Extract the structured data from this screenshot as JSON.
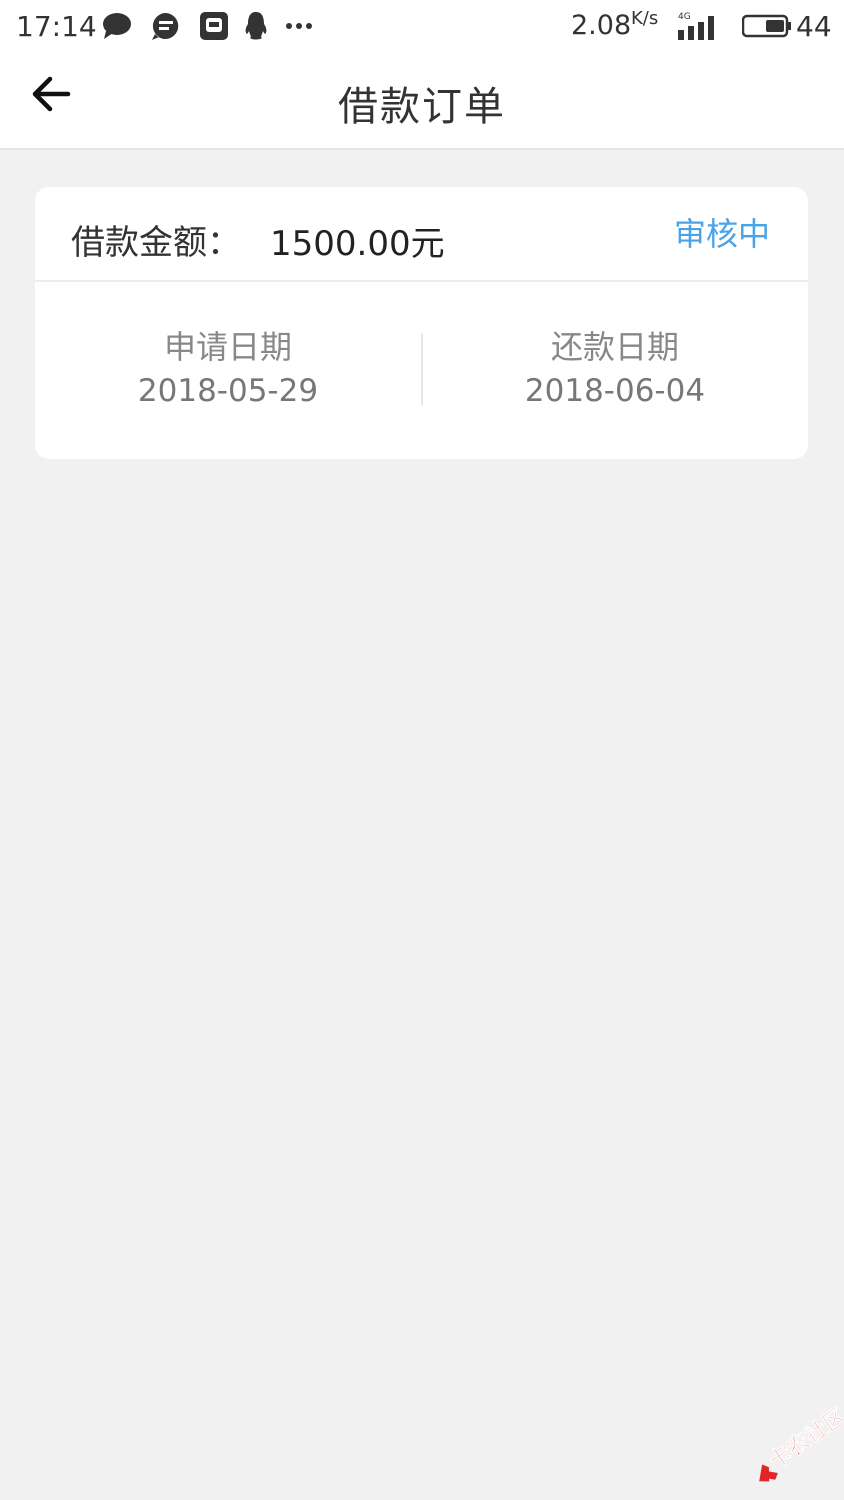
{
  "status_bar": {
    "time": "17:14",
    "net_speed": "2.08",
    "net_speed_unit": "K/s",
    "network_type": "4G",
    "battery_level": "44",
    "notification_icons": [
      "chat-bubble-icon",
      "message-icon",
      "app-icon",
      "qq-penguin-icon",
      "more-dots-icon"
    ]
  },
  "app_bar": {
    "title": "借款订单",
    "back_icon": "arrow-left-icon"
  },
  "order": {
    "amount_label": "借款金额：",
    "amount_value": "1500.00元",
    "status": "审核中",
    "apply_date_label": "申请日期",
    "apply_date": "2018-05-29",
    "repay_date_label": "还款日期",
    "repay_date": "2018-06-04"
  },
  "colors": {
    "background": "#f1f1f1",
    "card": "#ffffff",
    "status_accent": "#4aa3e6",
    "watermark": "#e0252b"
  },
  "watermark": {
    "text": "卡农社区"
  }
}
